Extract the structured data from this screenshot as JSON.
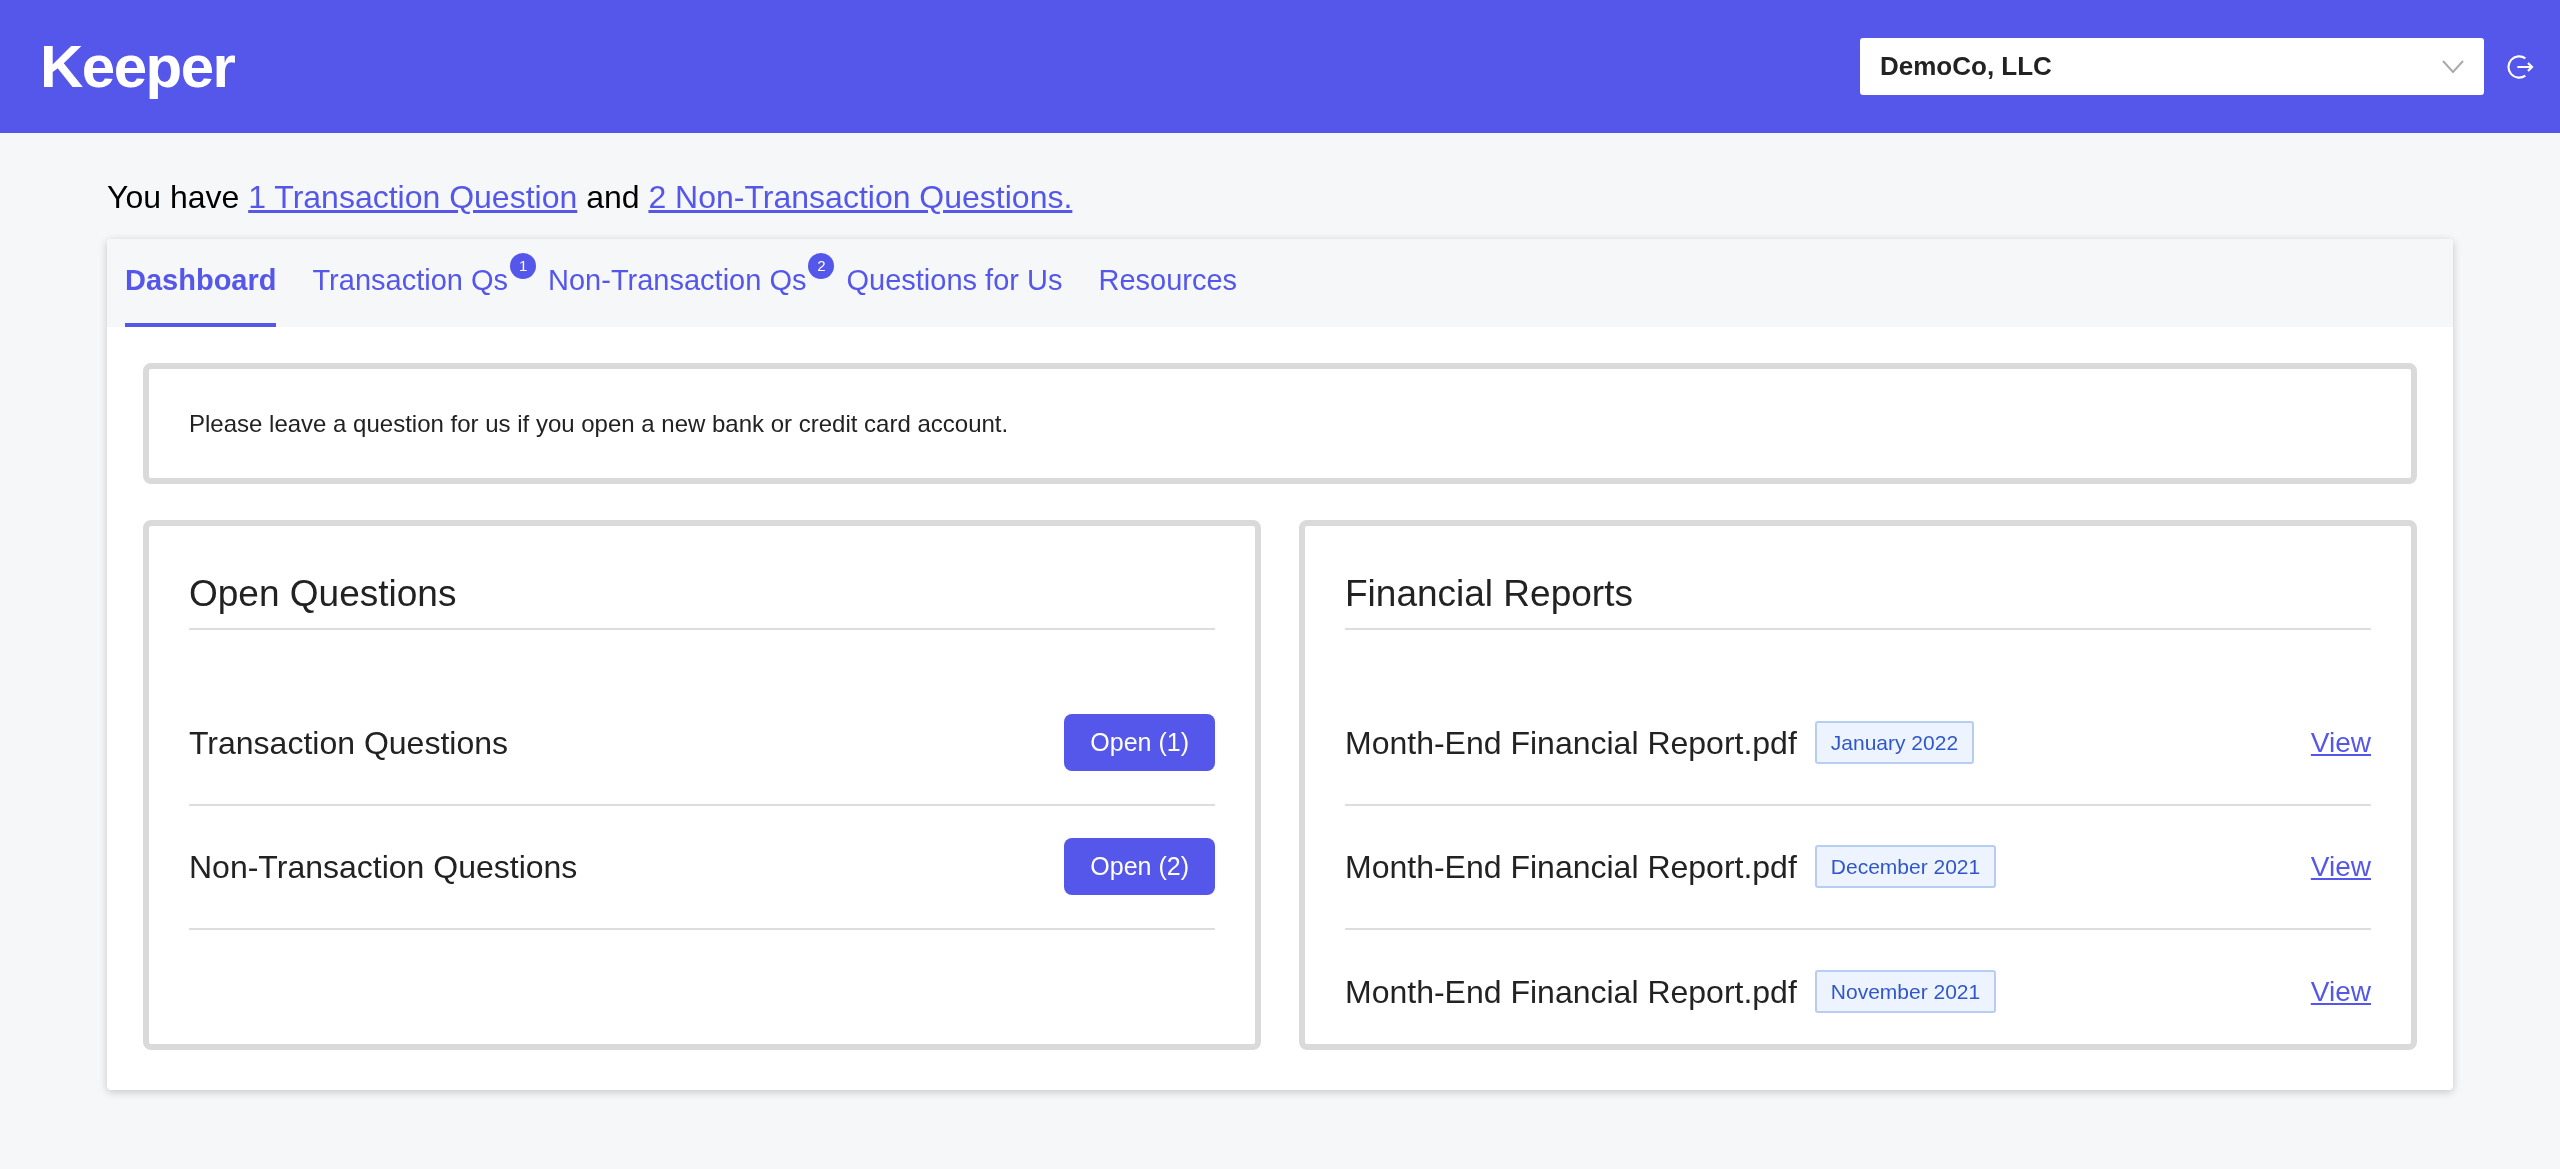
{
  "header": {
    "logo": "Keeper",
    "company_select": {
      "value": "DemoCo, LLC"
    }
  },
  "intro": {
    "text_1": "You have",
    "link_1": "1 Transaction Question",
    "text_2": "and",
    "link_2": "2 Non-Transaction Questions."
  },
  "tabs": [
    {
      "label": "Dashboard",
      "selected": true
    },
    {
      "label": "Transaction Qs",
      "selected": false,
      "badge": "1"
    },
    {
      "label": "Non-Transaction Qs",
      "selected": false,
      "badge": "2"
    },
    {
      "label": "Questions for Us",
      "selected": false
    },
    {
      "label": "Resources",
      "selected": false
    }
  ],
  "notice": "Please leave a question for us if you open a new bank or credit card account.",
  "open_questions": {
    "title": "Open Questions",
    "rows": [
      {
        "label": "Transaction Questions",
        "button": "Open (1)"
      },
      {
        "label": "Non-Transaction Questions",
        "button": "Open (2)"
      }
    ]
  },
  "financial_reports": {
    "title": "Financial Reports",
    "rows": [
      {
        "name": "Month-End Financial Report.pdf",
        "period": "January 2022",
        "link": "View"
      },
      {
        "name": "Month-End Financial Report.pdf",
        "period": "December 2021",
        "link": "View"
      },
      {
        "name": "Month-End Financial Report.pdf",
        "period": "November 2021",
        "link": "View"
      }
    ]
  }
}
